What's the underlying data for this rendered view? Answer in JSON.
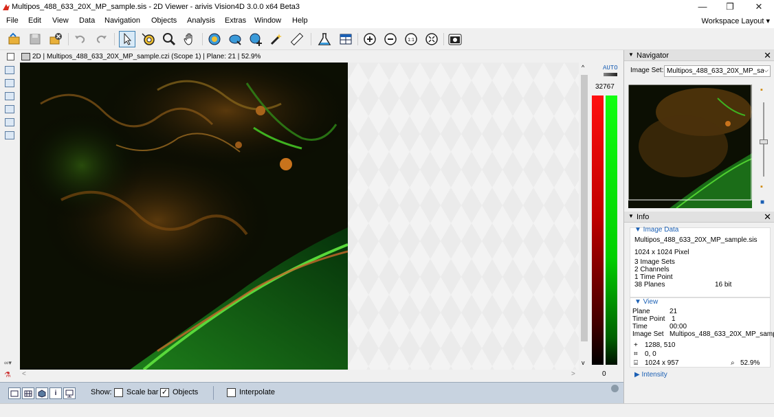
{
  "window": {
    "title": "Multipos_488_633_20X_MP_sample.sis - 2D Viewer - arivis Vision4D 3.0.0 x64 Beta3",
    "minimize": "—",
    "restore": "❐",
    "close": "✕"
  },
  "menu": {
    "items": [
      "File",
      "Edit",
      "View",
      "Data",
      "Navigation",
      "Objects",
      "Analysis",
      "Extras",
      "Window",
      "Help"
    ],
    "workspace_layout": "Workspace Layout ▾"
  },
  "viewer": {
    "header": "2D | Multipos_488_633_20X_MP_sample.czi (Scope 1) | Plane: 21 | 52.9%",
    "lut_auto": "AUTO",
    "lut_max": "32767",
    "lut_min": "0",
    "scroll_up": "^",
    "scroll_down": "v",
    "scroll_left": "<",
    "scroll_right": ">"
  },
  "bottom": {
    "show_label": "Show:",
    "scale_bar_label": "Scale bar",
    "scale_bar_checked": false,
    "objects_label": "Objects",
    "objects_checked": true,
    "interpolate_label": "Interpolate",
    "interpolate_checked": false,
    "info_button": "i"
  },
  "navigator": {
    "title": "Navigator",
    "image_set_label": "Image Set:",
    "image_set_value": "Multipos_488_633_20X_MP_sar",
    "close": "✕"
  },
  "info": {
    "title": "Info",
    "close": "✕",
    "image_data_header": "▼ Image Data",
    "file_name": "Multipos_488_633_20X_MP_sample.sis",
    "pixel_size": "1024 x 1024 Pixel",
    "image_sets": "3 Image Sets",
    "channels": "2 Channels",
    "time_points": "1 Time Point",
    "planes": "38 Planes",
    "bit_depth": "16 bit",
    "view_header": "▼ View",
    "plane_label": "Plane",
    "plane_value": "21",
    "time_point_label": "Time Point",
    "time_point_value": "1",
    "time_label": "Time",
    "time_value": "00:00",
    "image_set_label": "Image Set",
    "image_set_value": "Multipos_488_633_20X_MP_samp",
    "cursor_pos": "1288, 510",
    "offset": "0, 0",
    "view_size": "1024 x 957",
    "zoom": "52.9%",
    "intensity_header": "▶ Intensity"
  },
  "colors": {
    "accent": "#1a5fb4",
    "bottom_bar": "#c8d3e0",
    "lut_red": "#ff1010",
    "lut_green": "#12ff12"
  }
}
